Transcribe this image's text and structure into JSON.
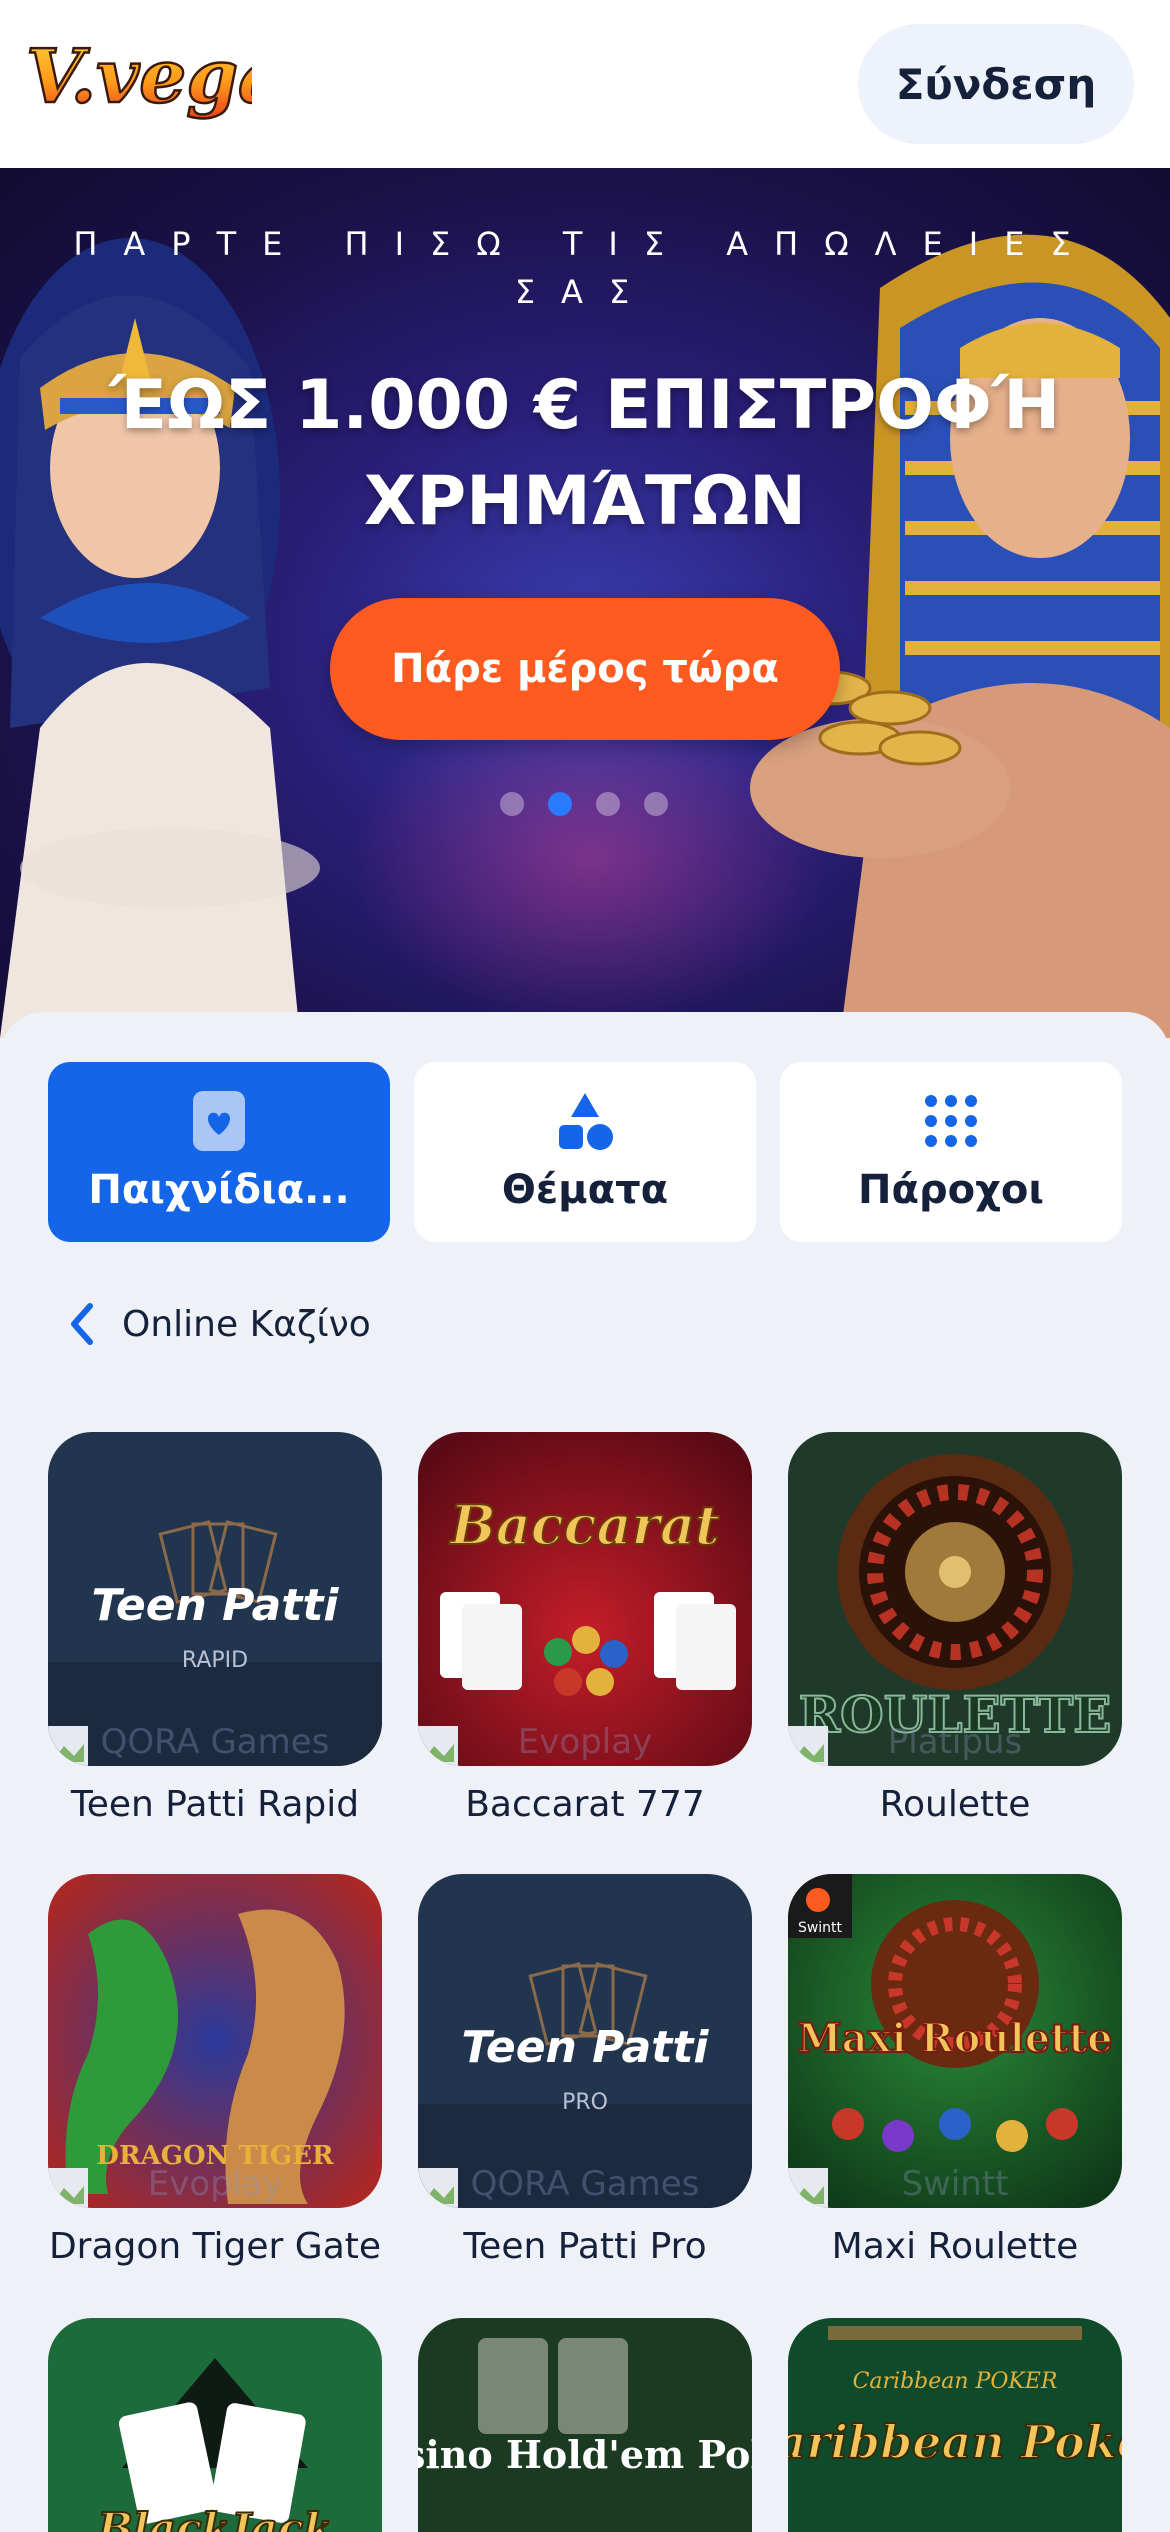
{
  "header": {
    "logo_text": "V.vegas",
    "login_label": "Σύνδεση"
  },
  "hero": {
    "subtitle": "ΠΑΡΤΕ ΠΙΣΩ ΤΙΣ ΑΠΩΛΕΙΕΣ ΣΑΣ",
    "title": "ΈΩΣ 1.000 € ΕΠΙΣΤΡΟΦΉ ΧΡΗΜΆΤΩΝ",
    "cta_label": "Πάρε μέρος τώρα",
    "slides_total": 4,
    "active_slide": 2
  },
  "tabs": [
    {
      "label": "Παιχνίδια...",
      "icon": "card-heart-icon",
      "active": true
    },
    {
      "label": "Θέματα",
      "icon": "shapes-icon",
      "active": false
    },
    {
      "label": "Πάροχοι",
      "icon": "grid-dots-icon",
      "active": false
    }
  ],
  "breadcrumb": {
    "back_icon": "chevron-left-icon",
    "label": "Online Καζίνο"
  },
  "games": [
    {
      "name": "Teen Patti Rapid",
      "provider": "QORA Games",
      "art_text": "Teen Patti",
      "art_sub": "RAPID"
    },
    {
      "name": "Baccarat 777",
      "provider": "Evoplay",
      "art_text": "Baccarat"
    },
    {
      "name": "Roulette",
      "provider": "Platipus",
      "art_text": "ROULETTE"
    },
    {
      "name": "Dragon Tiger Gate",
      "provider": "Evoplay",
      "art_text": "DRAGON TIGER"
    },
    {
      "name": "Teen Patti Pro",
      "provider": "QORA Games",
      "art_text": "Teen Patti",
      "art_sub": "PRO"
    },
    {
      "name": "Maxi Roulette",
      "provider": "Swintt",
      "art_text": "Maxi Roulette",
      "art_badge": "Swintt"
    },
    {
      "name": "",
      "provider": "",
      "art_text": "BlackJack"
    },
    {
      "name": "",
      "provider": "",
      "art_text": "Casino Hold'em Poker"
    },
    {
      "name": "",
      "provider": "",
      "art_text": "Caribbean Poker",
      "art_sub": "Caribbean POKER"
    }
  ],
  "colors": {
    "accent_blue": "#1565e8",
    "cta_orange": "#ff5a1f",
    "text_dark": "#15213b",
    "background": "#eef2f8"
  }
}
